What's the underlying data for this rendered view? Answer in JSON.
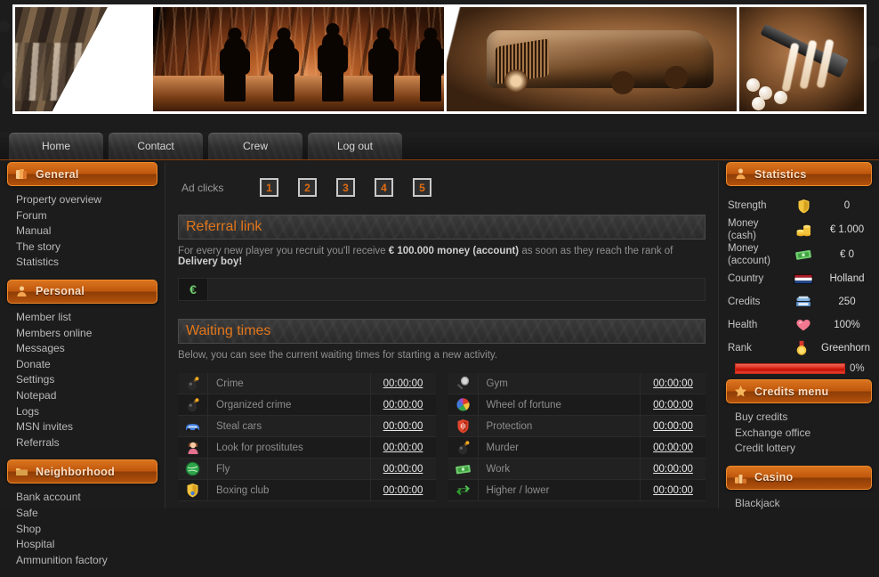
{
  "nav": {
    "tabs": [
      {
        "label": "Home",
        "name": "nav-tab-home"
      },
      {
        "label": "Contact",
        "name": "nav-tab-contact"
      },
      {
        "label": "Crew",
        "name": "nav-tab-crew"
      },
      {
        "label": "Log out",
        "name": "nav-tab-logout"
      }
    ]
  },
  "banner": {
    "panels": [
      "bullets-ammo-image",
      "crowd-silhouettes-image",
      "vintage-car-image",
      "drugs-paraphernalia-image"
    ]
  },
  "sidebar_left": {
    "sections": [
      {
        "title": "General",
        "icon": "books-icon",
        "items": [
          "Property overview",
          "Forum",
          "Manual",
          "The story",
          "Statistics"
        ]
      },
      {
        "title": "Personal",
        "icon": "person-icon",
        "items": [
          "Member list",
          "Members online",
          "Messages",
          "Donate",
          "Settings",
          "Notepad",
          "Logs",
          "MSN invites",
          "Referrals"
        ]
      },
      {
        "title": "Neighborhood",
        "icon": "folder-icon",
        "items": [
          "Bank account",
          "Safe",
          "Shop",
          "Hospital",
          "Ammunition factory"
        ]
      }
    ]
  },
  "main": {
    "ad_clicks": {
      "label": "Ad clicks",
      "buttons": [
        "1",
        "2",
        "3",
        "4",
        "5"
      ]
    },
    "referral": {
      "title": "Referral link",
      "description_pre": "For every new player you recruit you'll receive ",
      "description_bold1": "€ 100.000 money (account)",
      "description_mid": " as soon as they reach the rank of ",
      "description_bold2": "Delivery boy!",
      "input_value": "",
      "input_placeholder": "",
      "input_icon": "euro-currency-icon"
    },
    "waiting": {
      "title": "Waiting times",
      "subtitle": "Below, you can see the current waiting times for starting a new activity.",
      "left_column": [
        {
          "icon": "bomb-icon",
          "name": "Crime",
          "time": "00:00:00"
        },
        {
          "icon": "bomb-icon",
          "name": "Organized crime",
          "time": "00:00:00"
        },
        {
          "icon": "car-icon",
          "name": "Steal cars",
          "time": "00:00:00"
        },
        {
          "icon": "prostitute-icon",
          "name": "Look for prostitutes",
          "time": "00:00:00"
        },
        {
          "icon": "globe-icon",
          "name": "Fly",
          "time": "00:00:00"
        },
        {
          "icon": "shield-gold-icon",
          "name": "Boxing club",
          "time": "00:00:00"
        }
      ],
      "right_column": [
        {
          "icon": "racket-icon",
          "name": "Gym",
          "time": "00:00:00"
        },
        {
          "icon": "color-wheel-icon",
          "name": "Wheel of fortune",
          "time": "00:00:00"
        },
        {
          "icon": "shield-red-icon",
          "name": "Protection",
          "time": "00:00:00"
        },
        {
          "icon": "bomb-icon",
          "name": "Murder",
          "time": "00:00:00"
        },
        {
          "icon": "money-icon",
          "name": "Work",
          "time": "00:00:00"
        },
        {
          "icon": "arrows-cycle-icon",
          "name": "Higher / lower",
          "time": "00:00:00"
        }
      ]
    }
  },
  "sidebar_right": {
    "statistics": {
      "title": "Statistics",
      "icon": "person-icon",
      "rows": [
        {
          "label": "Strength",
          "icon": "shield-gold-icon",
          "value": "0"
        },
        {
          "label": "Money (cash)",
          "icon": "coins-icon",
          "value": "€ 1.000"
        },
        {
          "label": "Money (account)",
          "icon": "money-icon",
          "value": "€ 0"
        },
        {
          "label": "Country",
          "icon": "flag-netherlands-icon",
          "value": "Holland"
        },
        {
          "label": "Credits",
          "icon": "telephone-icon",
          "value": "250"
        },
        {
          "label": "Health",
          "icon": "heart-icon",
          "value": "100%"
        },
        {
          "label": "Rank",
          "icon": "medal-icon",
          "value": "Greenhorn"
        }
      ],
      "progress": {
        "percent": 0,
        "label": "0%",
        "fill_color": "#e03020"
      }
    },
    "credits_menu": {
      "title": "Credits menu",
      "icon": "star-icon",
      "items": [
        "Buy credits",
        "Exchange office",
        "Credit lottery"
      ]
    },
    "casino": {
      "title": "Casino",
      "icon": "chips-icon",
      "items": [
        "Blackjack"
      ]
    }
  },
  "colors": {
    "accent_orange": "#e2761b",
    "header_orange": "#c0570d",
    "background": "#1c1c1c",
    "panel": "#1e1e1e"
  }
}
